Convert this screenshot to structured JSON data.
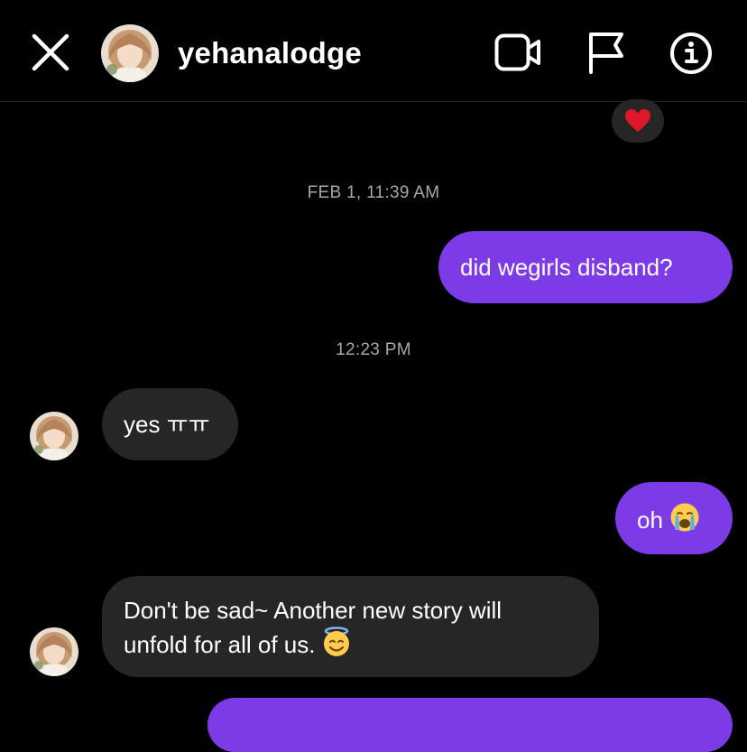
{
  "header": {
    "username": "yehanalodge",
    "icons": [
      "close-icon",
      "video-call-icon",
      "flag-icon",
      "info-icon"
    ]
  },
  "thread": {
    "reaction": "heart-emoji",
    "timestamp_1": "FEB 1, 11:39 AM",
    "msg_out_1": "did wegirls disband?",
    "timestamp_2": "12:23 PM",
    "msg_in_1": "yes ㅠㅠ",
    "msg_out_2": "oh",
    "msg_in_2_line1": "Don't be sad~ Another new story will",
    "msg_in_2_line2": "unfold for all of us."
  },
  "colors": {
    "outgoing_bubble": "#7d3be8",
    "incoming_bubble": "#262626",
    "background": "#000000",
    "timestamp": "#a8a8a8"
  }
}
